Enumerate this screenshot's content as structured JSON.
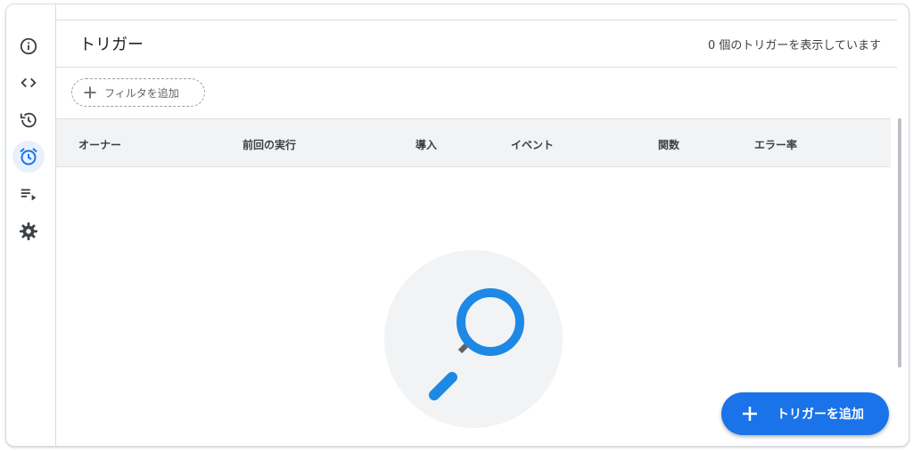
{
  "sidebar": {
    "items": [
      {
        "icon": "info-icon"
      },
      {
        "icon": "code-icon"
      },
      {
        "icon": "history-icon"
      },
      {
        "icon": "alarm-icon",
        "active": true
      },
      {
        "icon": "executions-icon"
      },
      {
        "icon": "settings-icon"
      }
    ]
  },
  "header": {
    "title": "トリガー",
    "count_text": "0 個のトリガーを表示しています"
  },
  "filter": {
    "label": "フィルタを追加",
    "icon": "plus-icon"
  },
  "table": {
    "columns": [
      "オーナー",
      "前回の実行",
      "導入",
      "イベント",
      "関数",
      "エラー率"
    ],
    "rows": []
  },
  "empty_state": {
    "icon": "magnifier-icon"
  },
  "fab": {
    "label": "トリガーを追加",
    "icon": "plus-icon"
  },
  "colors": {
    "accent": "#1a73e8",
    "magnifier": "#1e88e5",
    "active_bg": "#e8f0fe"
  }
}
